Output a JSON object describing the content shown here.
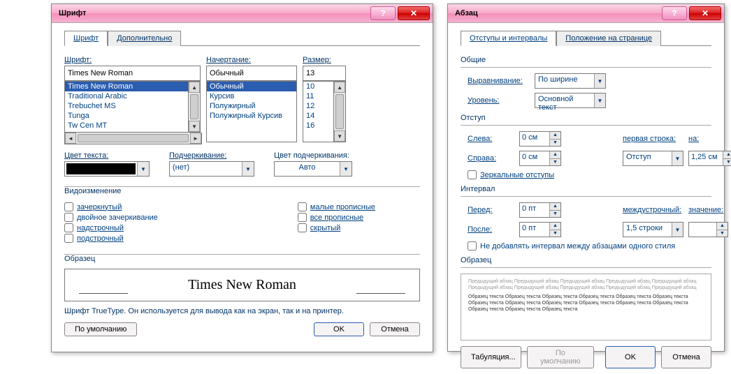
{
  "font_dialog": {
    "title": "Шрифт",
    "tabs": [
      "Шрифт",
      "Дополнительно"
    ],
    "labels": {
      "font": "Шрифт:",
      "style": "Начертание:",
      "size": "Размер:",
      "text_color": "Цвет текста:",
      "underline": "Подчеркивание:",
      "underline_color": "Цвет подчеркивания:"
    },
    "font_value": "Times New Roman",
    "font_list": [
      "Times New Roman",
      "Traditional Arabic",
      "Trebuchet MS",
      "Tunga",
      "Tw Cen MT"
    ],
    "style_value": "Обычный",
    "style_list": [
      "Обычный",
      "Курсив",
      "Полужирный",
      "Полужирный Курсив"
    ],
    "size_value": "13",
    "size_list": [
      "10",
      "11",
      "12",
      "14",
      "16"
    ],
    "underline_value": "(нет)",
    "underline_color_value": "Авто",
    "effects_title": "Видоизменение",
    "effects_left": [
      "зачеркнутый",
      "двойное зачеркивание",
      "надстрочный",
      "подстрочный"
    ],
    "effects_right": [
      "малые прописные",
      "все прописные",
      "скрытый"
    ],
    "preview_title": "Образец",
    "preview_text": "Times New Roman",
    "note": "Шрифт TrueType. Он используется для вывода как на экран, так и на принтер.",
    "buttons": {
      "default": "По умолчанию",
      "ok": "OK",
      "cancel": "Отмена"
    }
  },
  "para_dialog": {
    "title": "Абзац",
    "tabs": [
      "Отступы и интервалы",
      "Положение на странице"
    ],
    "group_general": "Общие",
    "align_label": "Выравнивание:",
    "align_value": "По ширине",
    "level_label": "Уровень:",
    "level_value": "Основной текст",
    "group_indent": "Отступ",
    "left_label": "Слева:",
    "left_value": "0 см",
    "right_label": "Справа:",
    "right_value": "0 см",
    "firstline_label": "первая строка:",
    "firstline_value": "Отступ",
    "on_label": "на:",
    "on_value": "1,25 см",
    "mirror_label": "Зеркальные отступы",
    "group_spacing": "Интервал",
    "before_label": "Перед:",
    "before_value": "0 пт",
    "after_label": "После:",
    "after_value": "0 пт",
    "linespacing_label": "междустрочный:",
    "linespacing_value": "1,5 строки",
    "value_label": "значение:",
    "value_value": "",
    "nosamespace_label": "Не добавлять интервал между абзацами одного стиля",
    "preview_title": "Образец",
    "preview_grey": "Предыдущий абзац Предыдущий абзац Предыдущий абзац Предыдущий абзац Предыдущий абзац Предыдущий абзац Предыдущий абзац Предыдущий абзац Предыдущий абзац Предыдущий абзац",
    "preview_dark": "Образец текста Образец текста Образец текста Образец текста Образец текста Образец текста Образец текста Образец текста Образец текста Образец текста Образец текста Образец текста Образец текста Образец текста Образец текста",
    "buttons": {
      "tabs": "Табуляция...",
      "default": "По умолчанию",
      "ok": "OK",
      "cancel": "Отмена"
    }
  }
}
